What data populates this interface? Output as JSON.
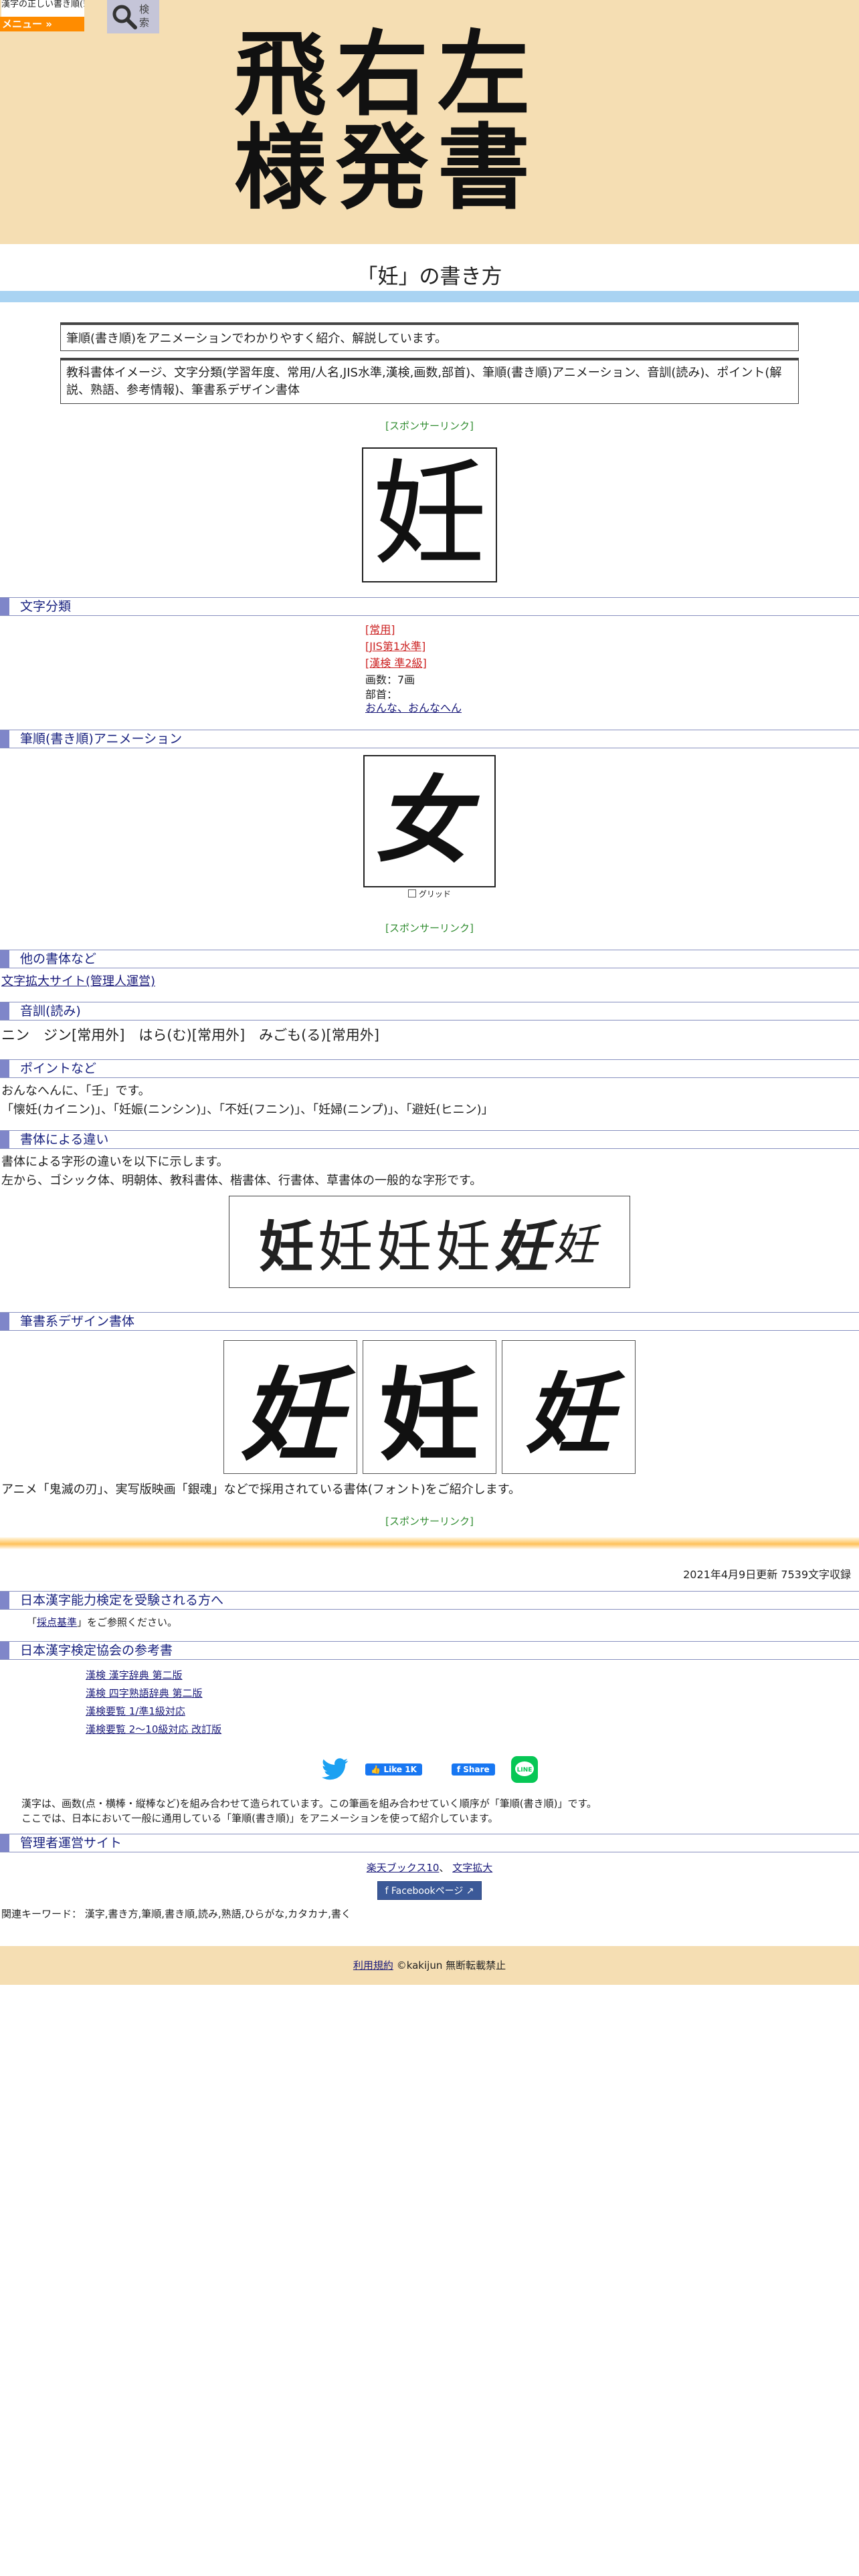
{
  "header": {
    "mini_logo": "漢字の正しい書き順(筆順)",
    "menu_label": "メニュー »",
    "search_label": "検索",
    "hero_line1": "飛右左",
    "hero_line2": "様発書"
  },
  "title": "「妊」の書き方",
  "intro": {
    "box1": "筆順(書き順)をアニメーションでわかりやすく紹介、解説しています。",
    "box2": "教科書体イメージ、文字分類(学習年度、常用/人名,JIS水準,漢検,画数,部首)、筆順(書き順)アニメーション、音訓(読み)、ポイント(解説、熟語、参考情報)、筆書系デザイン書体"
  },
  "sponsor_label": "[スポンサーリンク]",
  "kanji": "妊",
  "sections": {
    "classification": "文字分類",
    "animation": "筆順(書き順)アニメーション",
    "other_fonts": "他の書体など",
    "readings": "音訓(読み)",
    "points": "ポイントなど",
    "font_diff": "書体による違い",
    "design": "筆書系デザイン書体",
    "kentei": "日本漢字能力検定を受験される方へ",
    "kentei_ref": "日本漢字検定協会の参考書",
    "admin": "管理者運営サイト"
  },
  "classification": {
    "joyo": "[常用]",
    "jis": "[JIS第1水準]",
    "kanken": "[漢検 準2級]",
    "strokes": "画数：7画",
    "radical_label": "部首：",
    "radical": "おんな、おんなへん"
  },
  "animation": {
    "grid_label": "グリッド",
    "partial_glyph": "女"
  },
  "other_fonts": {
    "link": "文字拡大サイト(管理人運営)"
  },
  "readings": {
    "text": "ニン　ジン[常用外]　はら(む)[常用外]　みごも(る)[常用外]"
  },
  "points": {
    "line1": "おんなへんに、「壬」です。",
    "line2": "「懐妊(カイニン)」、「妊娠(ニンシン)」、「不妊(フニン)」、「妊婦(ニンプ)」、「避妊(ヒニン)」"
  },
  "font_diff": {
    "line1": "書体による字形の違いを以下に示します。",
    "line2": "左から、ゴシック体、明朝体、教科書体、楷書体、行書体、草書体の一般的な字形です。",
    "glyphs": [
      "妊",
      "妊",
      "妊",
      "妊",
      "妊",
      "妊"
    ]
  },
  "design": {
    "glyphs": [
      "妊",
      "妊",
      "妊"
    ],
    "caption": "アニメ「鬼滅の刃」、実写版映画「銀魂」などで採用されている書体(フォント)をご紹介します。"
  },
  "updated": "2021年4月9日更新 7539文字収録",
  "kentei": {
    "prefix": "「",
    "link": "採点基準",
    "suffix": "」をご参照ください。"
  },
  "references": [
    "漢検 漢字辞典 第二版",
    "漢検 四字熟語辞典 第二版",
    "漢検要覧 1/準1級対応",
    "漢検要覧 2～10級対応 改訂版"
  ],
  "social": {
    "like": "Like 1K",
    "share": "Share"
  },
  "explain": {
    "line1": "漢字は、画数(点・横棒・縦棒など)を組み合わせて造られています。この筆画を組み合わせていく順序が「筆順(書き順)」です。",
    "line2": "ここでは、日本において一般に通用している「筆順(書き順)」をアニメーションを使って紹介しています。"
  },
  "admin": {
    "link1": "楽天ブックス10",
    "link2": "文字拡大",
    "facebook": "Facebookページ"
  },
  "keywords": "関連キーワード： 漢字,書き方,筆順,書き順,読み,熟語,ひらがな,カタカナ,書く",
  "footer": {
    "terms": "利用規約",
    "copyright": "©kakijun 無断転載禁止"
  },
  "colors": {
    "header_bg": "#f5deb3",
    "menu_orange": "#ff8c00",
    "section_accent": "#7f86c9",
    "sponsor_green": "#2e8b2e"
  }
}
